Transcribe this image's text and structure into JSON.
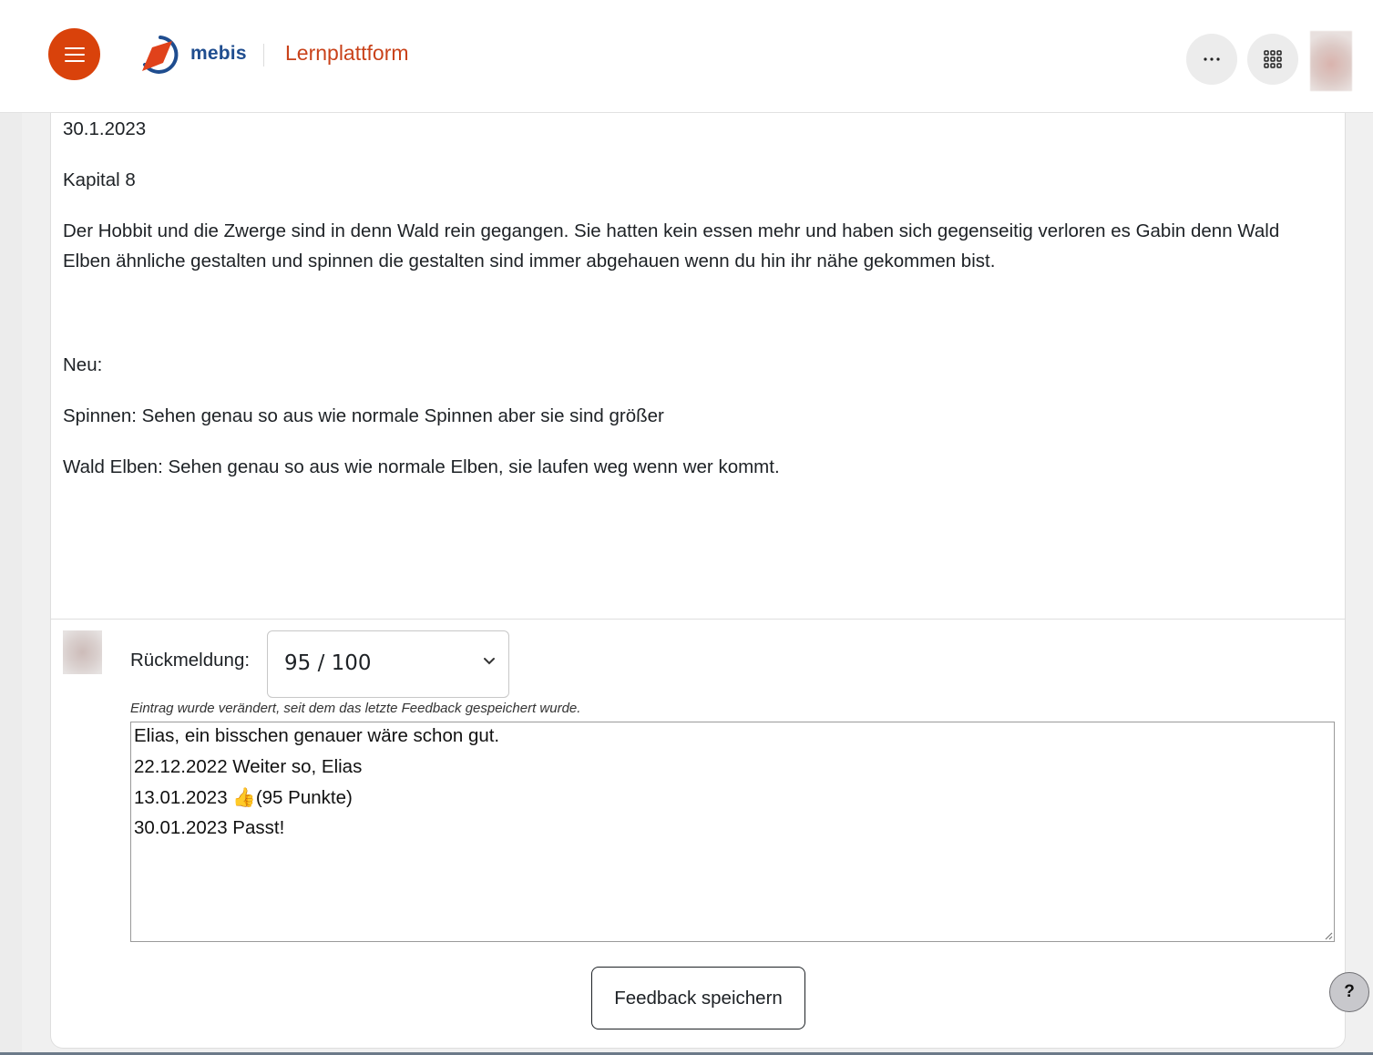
{
  "header": {
    "brand": "mebis",
    "platform": "Lernplattform"
  },
  "entry": {
    "date": "30.1.2023",
    "chapter": "Kapital 8",
    "paragraph": "Der Hobbit und die Zwerge sind in denn Wald rein gegangen. Sie hatten kein essen mehr und haben sich gegenseitig verloren es Gabin denn Wald Elben ähnliche gestalten und spinnen die gestalten sind immer abgehauen wenn du hin ihr nähe gekommen bist.",
    "new_heading": "Neu:",
    "new_item_1": "Spinnen: Sehen genau so aus wie normale Spinnen aber sie sind größer",
    "new_item_2": "Wald Elben: Sehen genau so aus wie normale Elben, sie laufen weg wenn wer kommt."
  },
  "feedback": {
    "label": "Rückmeldung:",
    "grade_selected": "95 / 100",
    "note": "Eintrag wurde verändert, seit dem das letzte Feedback gespeichert wurde.",
    "text_lines": [
      "Elias, ein bisschen genauer wäre schon gut.",
      "22.12.2022 Weiter so, Elias",
      "13.01.2023 👍(95 Punkte)",
      "30.01.2023 Passt!"
    ],
    "save_label": "Feedback speichern"
  },
  "help": {
    "label": "?"
  },
  "colors": {
    "accent": "#d9420b",
    "brand_blue": "#1f4d8f",
    "platform_orange": "#c9421a"
  },
  "icons": {
    "menu": "hamburger-menu-icon",
    "more": "ellipsis-icon",
    "apps": "grid-icon",
    "select": "chevron-down-icon"
  }
}
